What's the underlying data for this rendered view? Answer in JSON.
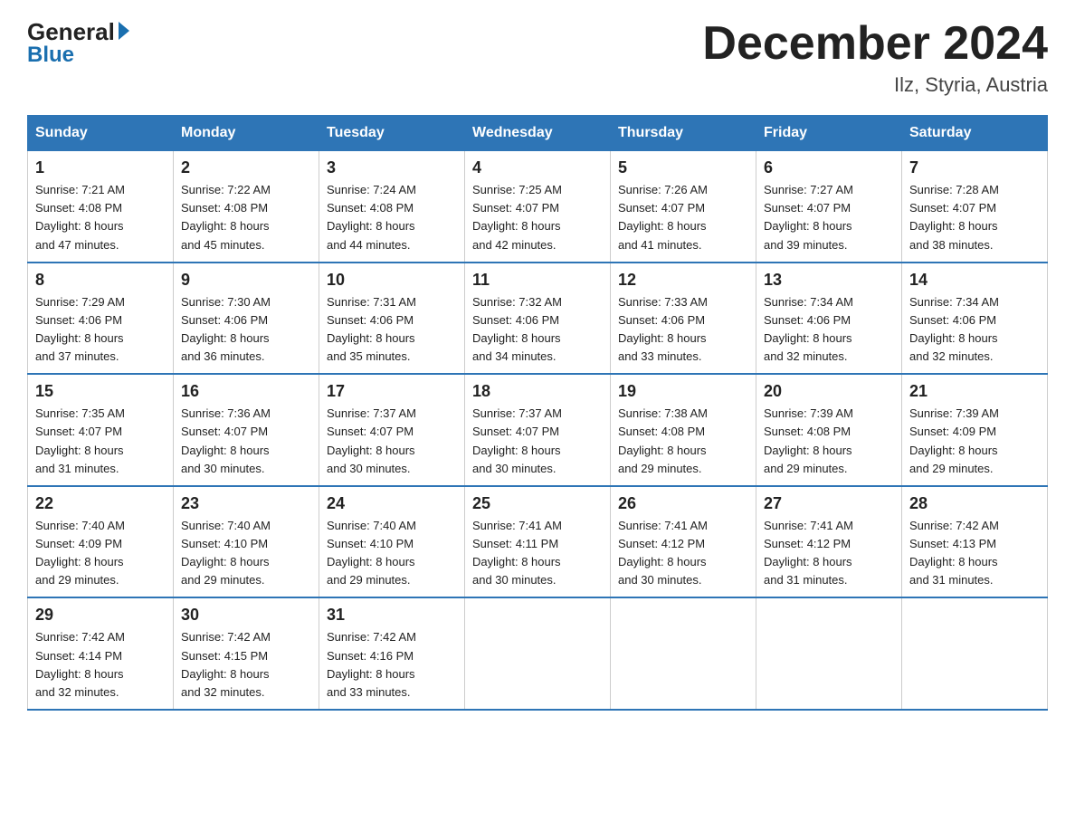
{
  "logo": {
    "general": "General",
    "blue": "Blue"
  },
  "title": "December 2024",
  "subtitle": "Ilz, Styria, Austria",
  "weekdays": [
    "Sunday",
    "Monday",
    "Tuesday",
    "Wednesday",
    "Thursday",
    "Friday",
    "Saturday"
  ],
  "weeks": [
    [
      {
        "day": "1",
        "sunrise": "7:21 AM",
        "sunset": "4:08 PM",
        "daylight": "8 hours and 47 minutes."
      },
      {
        "day": "2",
        "sunrise": "7:22 AM",
        "sunset": "4:08 PM",
        "daylight": "8 hours and 45 minutes."
      },
      {
        "day": "3",
        "sunrise": "7:24 AM",
        "sunset": "4:08 PM",
        "daylight": "8 hours and 44 minutes."
      },
      {
        "day": "4",
        "sunrise": "7:25 AM",
        "sunset": "4:07 PM",
        "daylight": "8 hours and 42 minutes."
      },
      {
        "day": "5",
        "sunrise": "7:26 AM",
        "sunset": "4:07 PM",
        "daylight": "8 hours and 41 minutes."
      },
      {
        "day": "6",
        "sunrise": "7:27 AM",
        "sunset": "4:07 PM",
        "daylight": "8 hours and 39 minutes."
      },
      {
        "day": "7",
        "sunrise": "7:28 AM",
        "sunset": "4:07 PM",
        "daylight": "8 hours and 38 minutes."
      }
    ],
    [
      {
        "day": "8",
        "sunrise": "7:29 AM",
        "sunset": "4:06 PM",
        "daylight": "8 hours and 37 minutes."
      },
      {
        "day": "9",
        "sunrise": "7:30 AM",
        "sunset": "4:06 PM",
        "daylight": "8 hours and 36 minutes."
      },
      {
        "day": "10",
        "sunrise": "7:31 AM",
        "sunset": "4:06 PM",
        "daylight": "8 hours and 35 minutes."
      },
      {
        "day": "11",
        "sunrise": "7:32 AM",
        "sunset": "4:06 PM",
        "daylight": "8 hours and 34 minutes."
      },
      {
        "day": "12",
        "sunrise": "7:33 AM",
        "sunset": "4:06 PM",
        "daylight": "8 hours and 33 minutes."
      },
      {
        "day": "13",
        "sunrise": "7:34 AM",
        "sunset": "4:06 PM",
        "daylight": "8 hours and 32 minutes."
      },
      {
        "day": "14",
        "sunrise": "7:34 AM",
        "sunset": "4:06 PM",
        "daylight": "8 hours and 32 minutes."
      }
    ],
    [
      {
        "day": "15",
        "sunrise": "7:35 AM",
        "sunset": "4:07 PM",
        "daylight": "8 hours and 31 minutes."
      },
      {
        "day": "16",
        "sunrise": "7:36 AM",
        "sunset": "4:07 PM",
        "daylight": "8 hours and 30 minutes."
      },
      {
        "day": "17",
        "sunrise": "7:37 AM",
        "sunset": "4:07 PM",
        "daylight": "8 hours and 30 minutes."
      },
      {
        "day": "18",
        "sunrise": "7:37 AM",
        "sunset": "4:07 PM",
        "daylight": "8 hours and 30 minutes."
      },
      {
        "day": "19",
        "sunrise": "7:38 AM",
        "sunset": "4:08 PM",
        "daylight": "8 hours and 29 minutes."
      },
      {
        "day": "20",
        "sunrise": "7:39 AM",
        "sunset": "4:08 PM",
        "daylight": "8 hours and 29 minutes."
      },
      {
        "day": "21",
        "sunrise": "7:39 AM",
        "sunset": "4:09 PM",
        "daylight": "8 hours and 29 minutes."
      }
    ],
    [
      {
        "day": "22",
        "sunrise": "7:40 AM",
        "sunset": "4:09 PM",
        "daylight": "8 hours and 29 minutes."
      },
      {
        "day": "23",
        "sunrise": "7:40 AM",
        "sunset": "4:10 PM",
        "daylight": "8 hours and 29 minutes."
      },
      {
        "day": "24",
        "sunrise": "7:40 AM",
        "sunset": "4:10 PM",
        "daylight": "8 hours and 29 minutes."
      },
      {
        "day": "25",
        "sunrise": "7:41 AM",
        "sunset": "4:11 PM",
        "daylight": "8 hours and 30 minutes."
      },
      {
        "day": "26",
        "sunrise": "7:41 AM",
        "sunset": "4:12 PM",
        "daylight": "8 hours and 30 minutes."
      },
      {
        "day": "27",
        "sunrise": "7:41 AM",
        "sunset": "4:12 PM",
        "daylight": "8 hours and 31 minutes."
      },
      {
        "day": "28",
        "sunrise": "7:42 AM",
        "sunset": "4:13 PM",
        "daylight": "8 hours and 31 minutes."
      }
    ],
    [
      {
        "day": "29",
        "sunrise": "7:42 AM",
        "sunset": "4:14 PM",
        "daylight": "8 hours and 32 minutes."
      },
      {
        "day": "30",
        "sunrise": "7:42 AM",
        "sunset": "4:15 PM",
        "daylight": "8 hours and 32 minutes."
      },
      {
        "day": "31",
        "sunrise": "7:42 AM",
        "sunset": "4:16 PM",
        "daylight": "8 hours and 33 minutes."
      },
      null,
      null,
      null,
      null
    ]
  ],
  "labels": {
    "sunrise": "Sunrise:",
    "sunset": "Sunset:",
    "daylight": "Daylight:"
  }
}
